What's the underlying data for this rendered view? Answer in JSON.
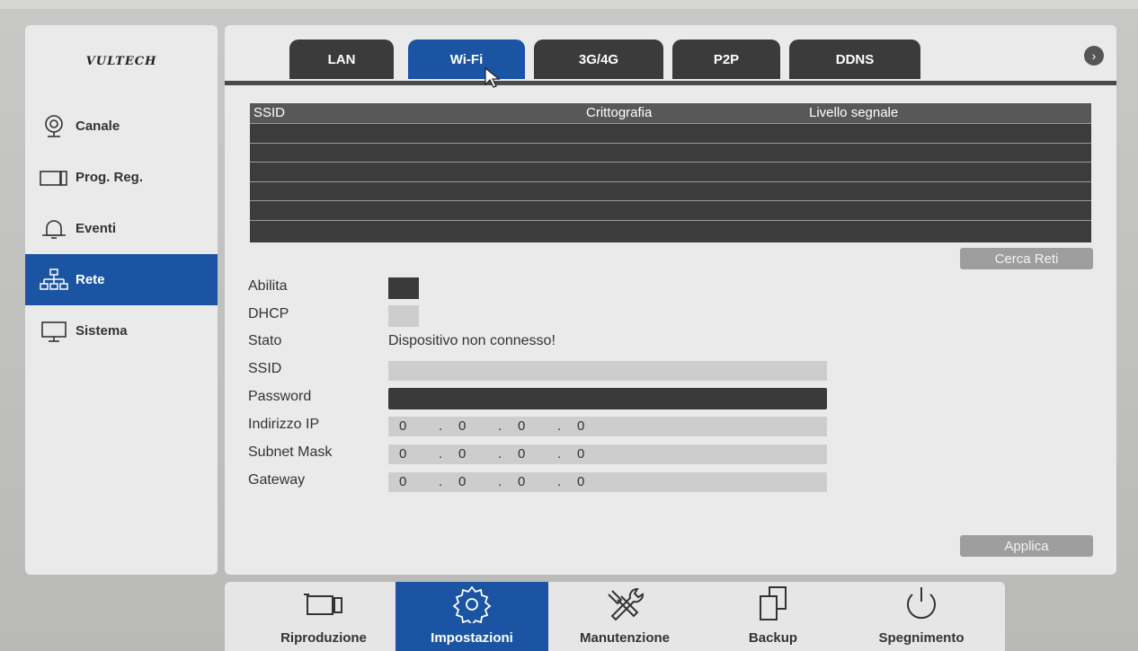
{
  "logo": {
    "text": "VULTECH"
  },
  "sidebar": {
    "items": [
      {
        "label": "Canale",
        "icon": "camera-icon"
      },
      {
        "label": "Prog. Reg.",
        "icon": "record-schedule-icon"
      },
      {
        "label": "Eventi",
        "icon": "bell-icon"
      },
      {
        "label": "Rete",
        "icon": "network-icon",
        "active": true
      },
      {
        "label": "Sistema",
        "icon": "monitor-icon"
      }
    ]
  },
  "tabs": [
    {
      "label": "LAN"
    },
    {
      "label": "Wi-Fi",
      "active": true
    },
    {
      "label": "3G/4G"
    },
    {
      "label": "P2P"
    },
    {
      "label": "DDNS"
    }
  ],
  "wifi_table": {
    "columns": [
      "SSID",
      "Crittografia",
      "Livello segnale"
    ],
    "rows": []
  },
  "buttons": {
    "search": "Cerca Reti",
    "apply": "Applica"
  },
  "form": {
    "enable_label": "Abilita",
    "dhcp_label": "DHCP",
    "status_label": "Stato",
    "status_value": "Dispositivo non connesso!",
    "ssid_label": "SSID",
    "ssid_value": "",
    "password_label": "Password",
    "password_value": "",
    "ip_label": "Indirizzo IP",
    "ip": [
      "0",
      "0",
      "0",
      "0"
    ],
    "mask_label": "Subnet Mask",
    "mask": [
      "0",
      "0",
      "0",
      "0"
    ],
    "gateway_label": "Gateway",
    "gateway": [
      "0",
      "0",
      "0",
      "0"
    ],
    "dot": "."
  },
  "bottom_bar": {
    "items": [
      {
        "label": "Riproduzione",
        "icon": "playback-camera-icon"
      },
      {
        "label": "Impostazioni",
        "icon": "settings-gear-icon",
        "active": true
      },
      {
        "label": "Manutenzione",
        "icon": "tools-icon"
      },
      {
        "label": "Backup",
        "icon": "copy-files-icon"
      },
      {
        "label": "Spegnimento",
        "icon": "power-icon"
      }
    ]
  },
  "colors": {
    "accent": "#1a54a3",
    "dark": "#3b3b3b",
    "panel": "#eaeaea"
  }
}
